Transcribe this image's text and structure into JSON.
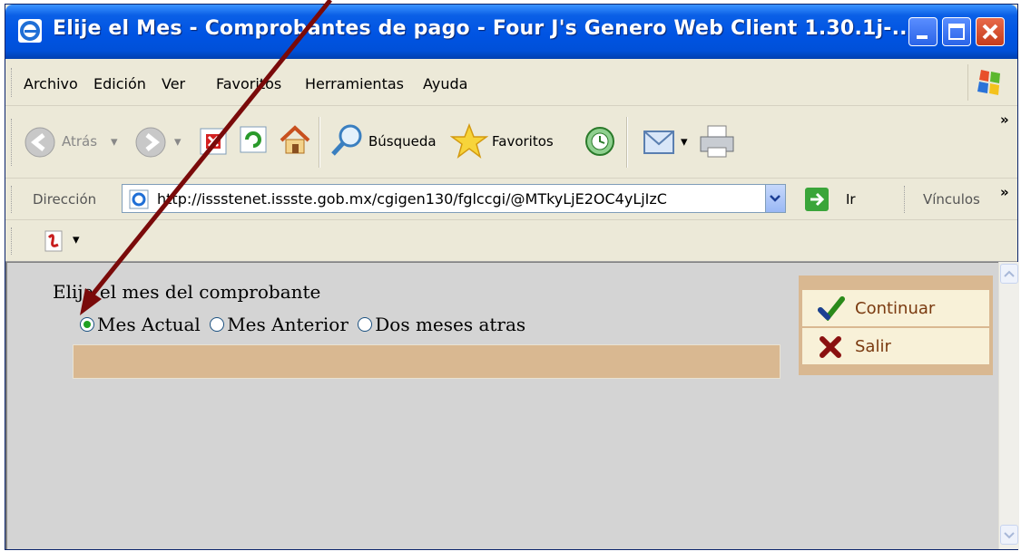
{
  "window": {
    "title": "Elije el Mes - Comprobantes de pago - Four J's Genero Web Client 1.30.1j-...",
    "controls": [
      "minimize",
      "maximize",
      "close"
    ]
  },
  "menubar": {
    "items": [
      "Archivo",
      "Edición",
      "Ver",
      "Favoritos",
      "Herramientas",
      "Ayuda"
    ]
  },
  "toolbar": {
    "back_label": "Atrás",
    "search_label": "Búsqueda",
    "favorites_label": "Favoritos",
    "overflow": "»"
  },
  "addressbar": {
    "label": "Dirección",
    "url": "http://issstenet.issste.gob.mx/cgigen130/fglccgi/@MTkyLjE2OC4yLjIzC",
    "go_label": "Ir",
    "links_label": "Vínculos",
    "overflow": "»"
  },
  "form": {
    "prompt": "Elija el mes del comprobante",
    "options": [
      {
        "label": "Mes Actual",
        "checked": true
      },
      {
        "label": "Mes Anterior",
        "checked": false
      },
      {
        "label": "Dos meses atras",
        "checked": false
      }
    ]
  },
  "actions": {
    "continue_label": "Continuar",
    "exit_label": "Salir"
  },
  "colors": {
    "titlebar": "#0054e3",
    "content_bg": "#d4d4d4",
    "panel": "#d9b891",
    "action_text": "#7a3a10",
    "annotation_arrow": "#7a0a0a"
  }
}
